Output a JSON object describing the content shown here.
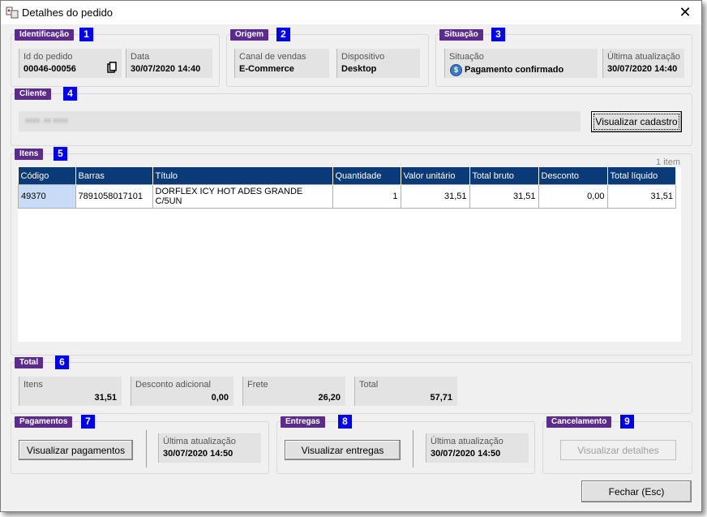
{
  "window": {
    "title": "Detalhes do pedido",
    "close_icon": "close-icon",
    "app_icon": "order-icon"
  },
  "identificacao": {
    "tag": "Identificação",
    "num": "1",
    "id_label": "Id do pedido",
    "id_value": "00046-00056",
    "data_label": "Data",
    "data_value": "30/07/2020 14:40"
  },
  "origem": {
    "tag": "Origem",
    "num": "2",
    "canal_label": "Canal de vendas",
    "canal_value": "E-Commerce",
    "disp_label": "Dispositivo",
    "disp_value": "Desktop"
  },
  "situacao": {
    "tag": "Situação",
    "num": "3",
    "sit_label": "Situação",
    "sit_value": "Pagamento confirmado",
    "sit_icon_text": "$",
    "upd_label": "Última atualização",
    "upd_value": "30/07/2020 14:40"
  },
  "cliente": {
    "tag": "Cliente",
    "num": "4",
    "name_blurred": "xxxx. xx xxxx",
    "button": "Visualizar cadastro"
  },
  "itens": {
    "tag": "Itens",
    "num": "5",
    "count": "1 item",
    "columns": [
      "Código",
      "Barras",
      "Título",
      "Quantidade",
      "Valor unitário",
      "Total bruto",
      "Desconto",
      "Total líquido"
    ],
    "rows": [
      [
        "49370",
        "7891058017101",
        "DORFLEX ICY HOT ADES GRANDE C/5UN",
        "1",
        "31,51",
        "31,51",
        "0,00",
        "31,51"
      ]
    ]
  },
  "total": {
    "tag": "Total",
    "num": "6",
    "itens_label": "Itens",
    "itens_value": "31,51",
    "desc_label": "Desconto adicional",
    "desc_value": "0,00",
    "frete_label": "Frete",
    "frete_value": "26,20",
    "total_label": "Total",
    "total_value": "57,71"
  },
  "pagamentos": {
    "tag": "Pagamentos",
    "num": "7",
    "button": "Visualizar pagamentos",
    "upd_label": "Última atualização",
    "upd_value": "30/07/2020 14:50"
  },
  "entregas": {
    "tag": "Entregas",
    "num": "8",
    "button": "Visualizar entregas",
    "upd_label": "Última atualização",
    "upd_value": "30/07/2020 14:50"
  },
  "cancelamento": {
    "tag": "Cancelamento",
    "num": "9",
    "button": "Visualizar detalhes"
  },
  "footer": {
    "close_button": "Fechar (Esc)"
  },
  "colors": {
    "tag_bg": "#5b2c8c",
    "num_bg": "#0000ee",
    "grid_header": "#0a3a78",
    "status_icon": "#3a78c8"
  }
}
